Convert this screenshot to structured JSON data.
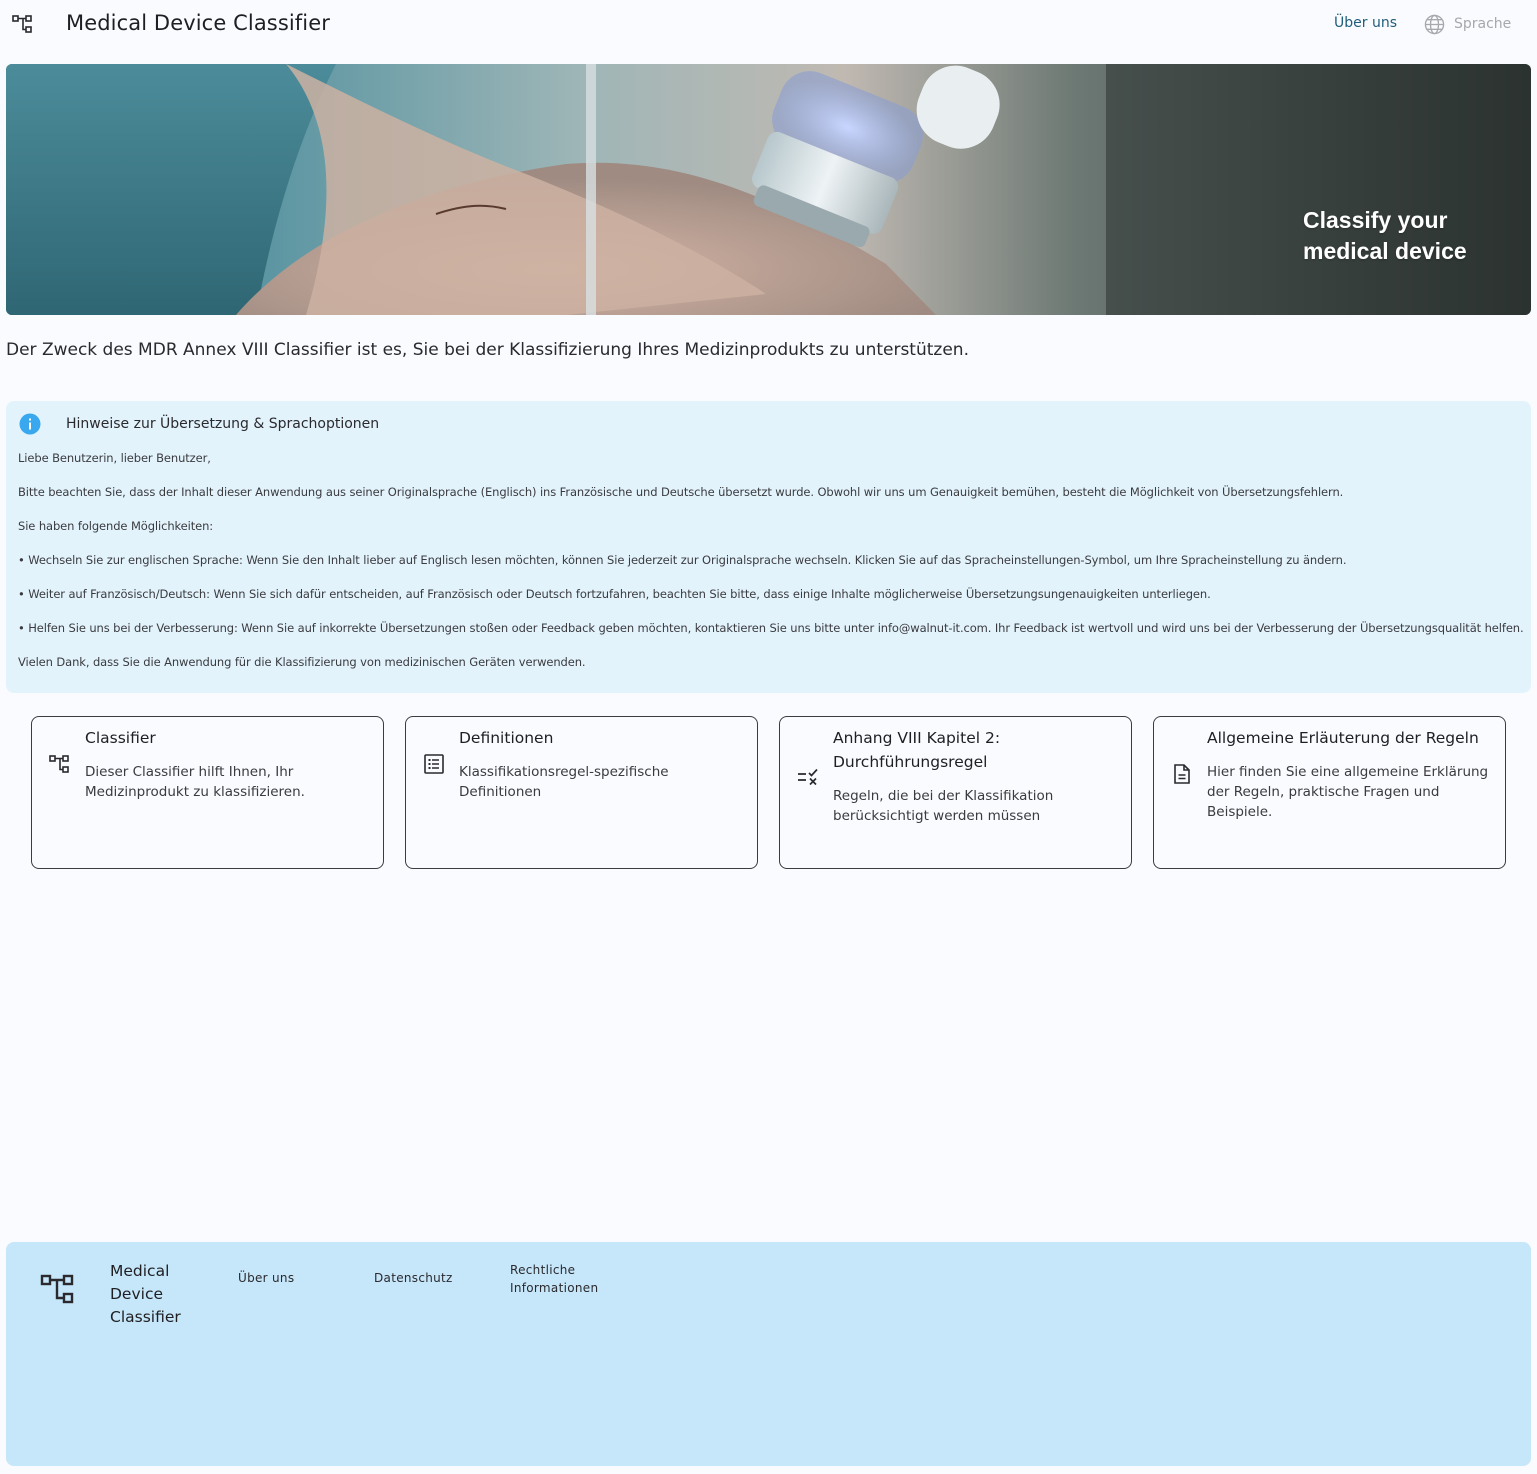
{
  "header": {
    "title": "Medical Device Classifier",
    "about_link": "Über uns",
    "language_label": "Sprache"
  },
  "hero": {
    "title_line1": "Classify your",
    "title_line2": "medical device"
  },
  "intro": "Der Zweck des MDR Annex VIII Classifier ist es, Sie bei der Klassifizierung Ihres Medizinprodukts zu unterstützen.",
  "notice": {
    "title": "Hinweise zur Übersetzung & Sprachoptionen",
    "paragraphs": [
      "Liebe Benutzerin, lieber Benutzer,",
      "Bitte beachten Sie, dass der Inhalt dieser Anwendung aus seiner Originalsprache (Englisch) ins Französische und Deutsche übersetzt wurde. Obwohl wir uns um Genauigkeit bemühen, besteht die Möglichkeit von Übersetzungsfehlern.",
      "Sie haben folgende Möglichkeiten:",
      "• Wechseln Sie zur englischen Sprache: Wenn Sie den Inhalt lieber auf Englisch lesen möchten, können Sie jederzeit zur Originalsprache wechseln. Klicken Sie auf das Spracheinstellungen-Symbol, um Ihre Spracheinstellung zu ändern.",
      "• Weiter auf Französisch/Deutsch: Wenn Sie sich dafür entscheiden, auf Französisch oder Deutsch fortzufahren, beachten Sie bitte, dass einige Inhalte möglicherweise Übersetzungsungenauigkeiten unterliegen.",
      "• Helfen Sie uns bei der Verbesserung: Wenn Sie auf inkorrekte Übersetzungen stoßen oder Feedback geben möchten, kontaktieren Sie uns bitte unter info@walnut-it.com. Ihr Feedback ist wertvoll und wird uns bei der Verbesserung der Übersetzungsqualität helfen.",
      "Vielen Dank, dass Sie die Anwendung für die Klassifizierung von medizinischen Geräten verwenden."
    ]
  },
  "cards": [
    {
      "title": "Classifier",
      "description": "Dieser Classifier hilft Ihnen, Ihr Medizinprodukt zu klassifizieren.",
      "icon": "hierarchy-icon"
    },
    {
      "title": "Definitionen",
      "description": "Klassifikationsregel-spezifische Definitionen",
      "icon": "list-icon"
    },
    {
      "title": "Anhang VIII Kapitel 2: Durchführungsregel",
      "description": "Regeln, die bei der Klassifikation berücksichtigt werden müssen",
      "icon": "rule-check-icon"
    },
    {
      "title": "Allgemeine Erläuterung der Regeln",
      "description": "Hier finden Sie eine allgemeine Erklärung der Regeln, praktische Fragen und Beispiele.",
      "icon": "document-icon"
    }
  ],
  "footer": {
    "brand": "Medical Device Classifier",
    "links": [
      "Über uns",
      "Datenschutz",
      "Rechtliche Informationen"
    ]
  },
  "colors": {
    "page_bg": "#f9fbfe",
    "notice_bg": "#e3f3fc",
    "footer_bg": "#c6e6fa",
    "info_icon": "#3aa8ee",
    "link": "#205e7a"
  }
}
